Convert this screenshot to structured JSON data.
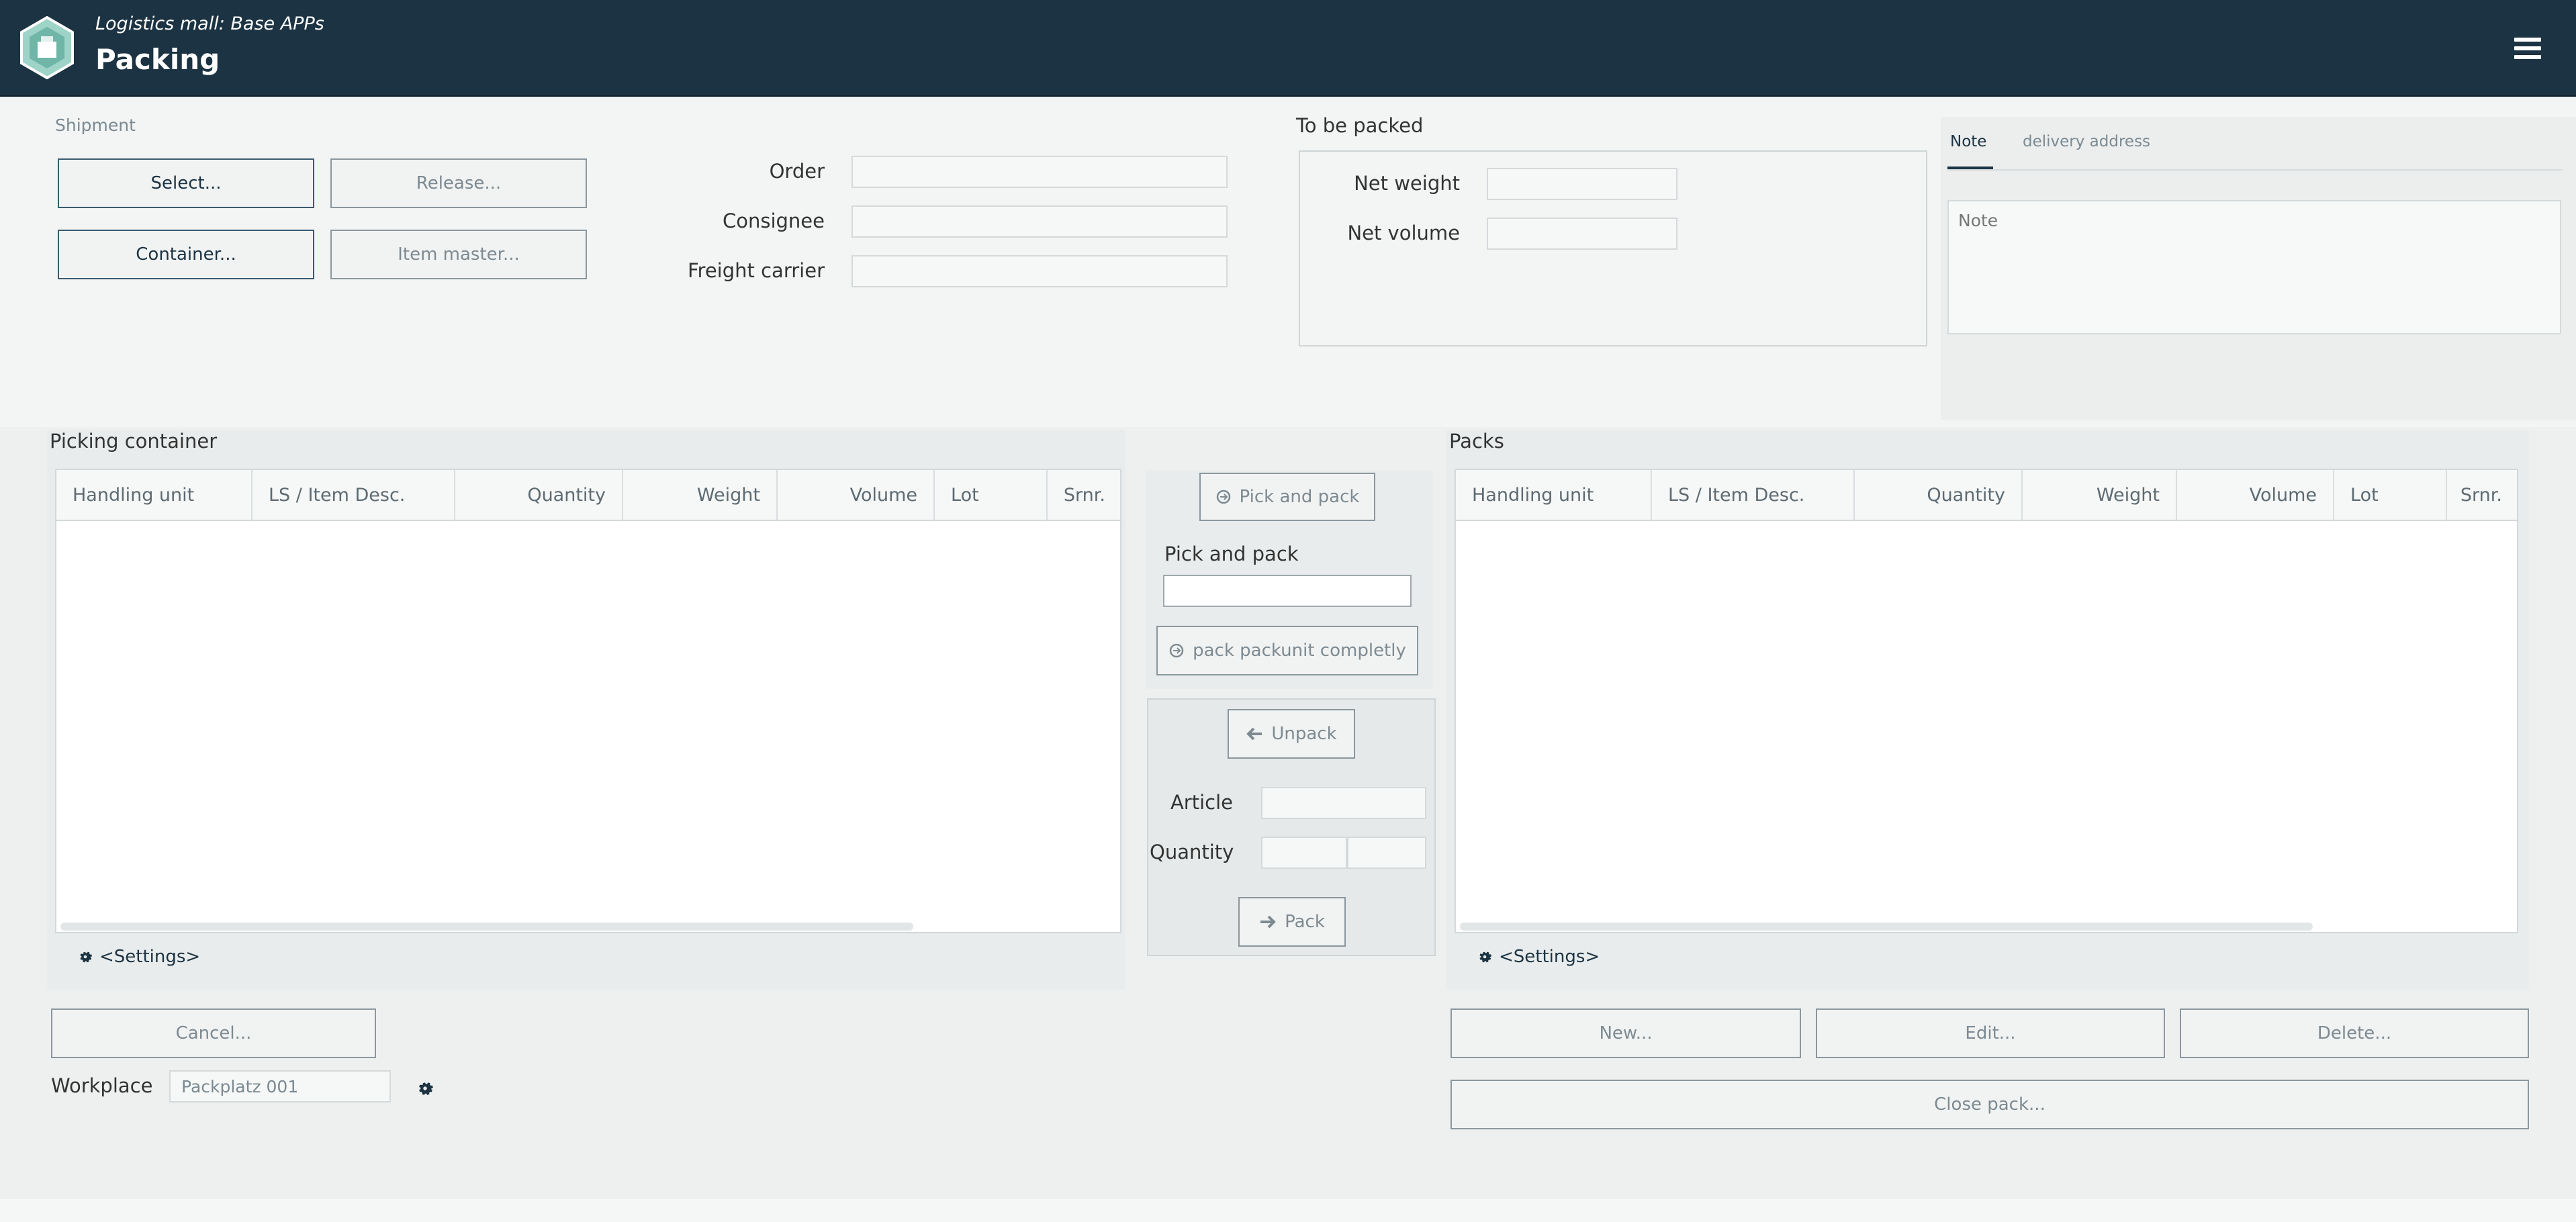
{
  "header": {
    "subtitle": "Logistics mall: Base APPs",
    "title": "Packing",
    "bg_color": "#1b3342"
  },
  "shipment": {
    "section_label": "Shipment",
    "select_label": "Select...",
    "release_label": "Release...",
    "container_label": "Container...",
    "item_master_label": "Item master...",
    "order_label": "Order",
    "consignee_label": "Consignee",
    "freight_carrier_label": "Freight carrier",
    "order_value": "",
    "consignee_value": "",
    "freight_carrier_value": ""
  },
  "to_be_packed": {
    "section_label": "To be packed",
    "net_weight_label": "Net weight",
    "net_volume_label": "Net volume",
    "net_weight_value": "",
    "net_volume_value": ""
  },
  "note_tabs": {
    "tabs": [
      "Note",
      "delivery address"
    ],
    "active": "Note",
    "note_placeholder": "Note"
  },
  "picking_container": {
    "title": "Picking container",
    "columns": [
      "Handling unit",
      "LS / Item Desc.",
      "Quantity",
      "Weight",
      "Volume",
      "Lot",
      "Srnr."
    ],
    "rows": [],
    "settings_label": "<Settings>"
  },
  "middle": {
    "pick_and_pack_button": "Pick and pack",
    "pick_and_pack_label": "Pick and pack",
    "pick_and_pack_value": "",
    "pack_packunit_button": "pack packunit completly",
    "unpack_button": "Unpack",
    "article_label": "Article",
    "quantity_label": "Quantity",
    "pack_button": "Pack"
  },
  "packs": {
    "title": "Packs",
    "columns": [
      "Handling unit",
      "LS / Item Desc.",
      "Quantity",
      "Weight",
      "Volume",
      "Lot",
      "Srnr."
    ],
    "rows": [],
    "settings_label": "<Settings>",
    "new_label": "New...",
    "edit_label": "Edit...",
    "delete_label": "Delete...",
    "close_pack_label": "Close pack..."
  },
  "footer": {
    "cancel_label": "Cancel...",
    "workplace_label": "Workplace",
    "workplace_value": "Packplatz 001"
  }
}
